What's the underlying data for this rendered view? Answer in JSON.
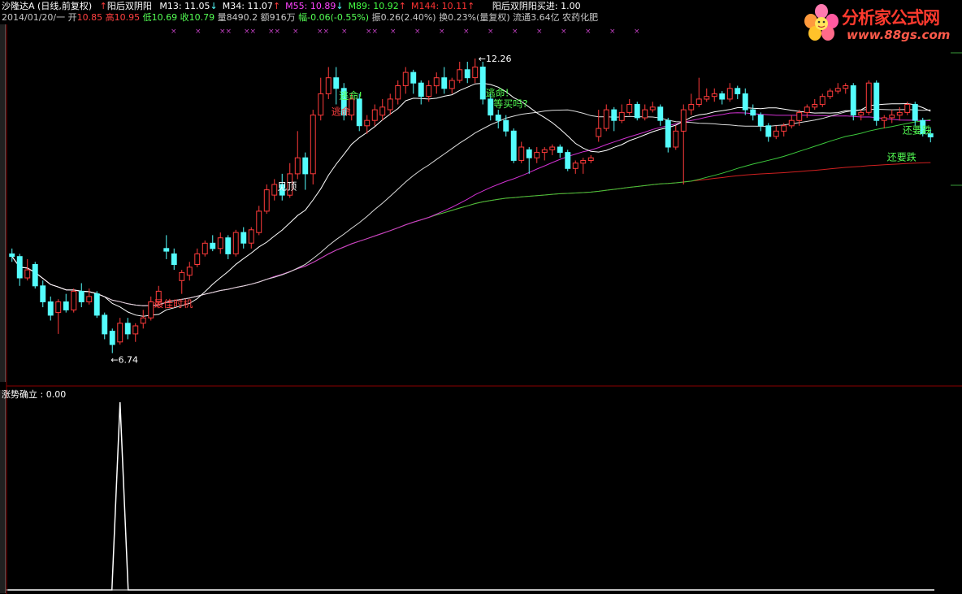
{
  "header": {
    "stock_name": "沙隆达A",
    "chart_mode": "(日线,前复权)",
    "indicator_name": "阳后双阴阳",
    "ma": [
      {
        "label": "M13:",
        "value": "11.05",
        "arrow": "↓",
        "color": "#ffffff"
      },
      {
        "label": "M34:",
        "value": "11.07",
        "arrow": "↑",
        "color": "#ffffff"
      },
      {
        "label": "M55:",
        "value": "10.89",
        "arrow": "↓",
        "color": "#ff44ff"
      },
      {
        "label": "M89:",
        "value": "10.92",
        "arrow": "↑",
        "color": "#44ff44"
      },
      {
        "label": "M144:",
        "value": "10.11",
        "arrow": "↑",
        "color": "#ff3333"
      }
    ],
    "buy_label": "阳后双阴阳买进:",
    "buy_value": "1.00"
  },
  "info_line": {
    "date": "2014/01/20/一",
    "open_label": "开",
    "open": "10.85",
    "high_label": "高",
    "high": "10.95",
    "low_label": "低",
    "low": "10.69",
    "close_label": "收",
    "close": "10.79",
    "volume_label": "量",
    "volume": "8490.2",
    "amount_label": "额",
    "amount": "916万",
    "change_label": "幅",
    "change": "-0.06(-0.55%)",
    "amplitude_label": "振",
    "amplitude": "0.26(2.40%)",
    "turnover_label": "换",
    "turnover": "0.23%(量复权)",
    "float_label": "流通",
    "float": "3.64亿",
    "sector": "农药化肥"
  },
  "logo": {
    "name": "分析家公式网",
    "url": "www.88gs.com"
  },
  "sub_panel": {
    "label": "涨势确立 :",
    "value": "0.00"
  },
  "colors": {
    "up": "#ff3b3b",
    "down": "#54fcfc",
    "m13": "#ffffff",
    "m34": "#dcdcdc",
    "m55": "#d030d0",
    "m89": "#3cc83c",
    "m144": "#d02020",
    "signal": "#ffffff"
  },
  "chart_data": {
    "type": "candlestick",
    "y_scale": {
      "min": 6.2,
      "max": 12.9
    },
    "high_marker": "12.26",
    "low_marker": "6.74",
    "candles": [
      [
        8.6,
        8.55,
        8.7,
        8.45
      ],
      [
        8.55,
        8.15,
        8.6,
        8.0
      ],
      [
        8.15,
        8.3,
        8.5,
        8.1
      ],
      [
        8.4,
        8.0,
        8.45,
        7.95
      ],
      [
        8.0,
        7.7,
        8.1,
        7.6
      ],
      [
        7.7,
        7.45,
        7.8,
        7.35
      ],
      [
        7.5,
        7.7,
        7.75,
        7.1
      ],
      [
        7.7,
        7.55,
        7.85,
        7.5
      ],
      [
        7.55,
        7.9,
        7.95,
        7.5
      ],
      [
        7.9,
        7.7,
        8.05,
        7.6
      ],
      [
        7.7,
        7.8,
        7.95,
        7.65
      ],
      [
        7.85,
        7.45,
        7.9,
        7.4
      ],
      [
        7.45,
        7.1,
        7.5,
        7.0
      ],
      [
        7.15,
        6.9,
        7.2,
        6.74
      ],
      [
        6.95,
        7.3,
        7.4,
        6.9
      ],
      [
        7.3,
        7.1,
        7.4,
        7.0
      ],
      [
        7.1,
        7.25,
        7.3,
        6.95
      ],
      [
        7.3,
        7.4,
        7.55,
        7.2
      ],
      [
        7.4,
        7.7,
        7.8,
        7.35
      ],
      [
        7.7,
        7.9,
        8.0,
        7.65
      ],
      [
        8.7,
        8.65,
        8.95,
        8.5
      ],
      [
        8.6,
        8.4,
        8.7,
        8.3
      ],
      [
        8.1,
        8.25,
        8.3,
        7.85
      ],
      [
        8.2,
        8.35,
        8.45,
        8.1
      ],
      [
        8.4,
        8.6,
        8.7,
        8.35
      ],
      [
        8.6,
        8.8,
        8.85,
        8.55
      ],
      [
        8.8,
        8.7,
        8.95,
        8.65
      ],
      [
        8.7,
        8.9,
        9.0,
        8.6
      ],
      [
        8.9,
        8.6,
        8.95,
        8.5
      ],
      [
        8.6,
        9.0,
        9.05,
        8.55
      ],
      [
        9.0,
        8.8,
        9.1,
        8.7
      ],
      [
        8.8,
        9.05,
        9.1,
        8.7
      ],
      [
        9.0,
        9.4,
        9.5,
        8.95
      ],
      [
        9.4,
        9.8,
        9.9,
        9.35
      ],
      [
        9.7,
        9.9,
        10.0,
        9.6
      ],
      [
        9.9,
        9.7,
        10.1,
        9.6
      ],
      [
        9.7,
        10.1,
        10.3,
        9.65
      ],
      [
        10.1,
        10.4,
        10.9,
        10.0
      ],
      [
        10.4,
        10.1,
        10.5,
        9.8
      ],
      [
        10.1,
        11.2,
        11.3,
        9.9
      ],
      [
        11.2,
        11.6,
        11.9,
        11.1
      ],
      [
        11.6,
        11.9,
        12.1,
        11.5
      ],
      [
        11.9,
        11.7,
        12.1,
        11.4
      ],
      [
        11.7,
        11.2,
        11.8,
        11.1
      ],
      [
        11.2,
        11.5,
        11.6,
        11.1
      ],
      [
        11.5,
        11.0,
        11.6,
        10.9
      ],
      [
        11.0,
        11.1,
        11.2,
        10.85
      ],
      [
        11.1,
        11.3,
        11.4,
        11.0
      ],
      [
        11.2,
        11.35,
        11.5,
        11.1
      ],
      [
        11.3,
        11.5,
        11.6,
        11.2
      ],
      [
        11.5,
        11.75,
        11.85,
        11.4
      ],
      [
        11.75,
        12.0,
        12.1,
        11.6
      ],
      [
        12.0,
        11.8,
        12.05,
        11.6
      ],
      [
        11.8,
        11.55,
        11.85,
        11.4
      ],
      [
        11.55,
        11.75,
        11.85,
        11.45
      ],
      [
        11.75,
        11.9,
        12.0,
        11.6
      ],
      [
        11.9,
        11.7,
        12.1,
        11.6
      ],
      [
        11.7,
        11.85,
        11.9,
        11.6
      ],
      [
        11.85,
        12.05,
        12.2,
        11.8
      ],
      [
        12.05,
        11.9,
        12.2,
        11.8
      ],
      [
        11.9,
        12.1,
        12.26,
        11.8
      ],
      [
        12.1,
        11.5,
        12.2,
        11.4
      ],
      [
        11.5,
        11.2,
        11.6,
        11.1
      ],
      [
        11.2,
        11.1,
        11.3,
        10.95
      ],
      [
        11.1,
        10.9,
        11.2,
        10.8
      ],
      [
        10.9,
        10.35,
        10.95,
        10.3
      ],
      [
        10.35,
        10.6,
        10.7,
        10.3
      ],
      [
        10.55,
        10.4,
        10.6,
        10.1
      ],
      [
        10.4,
        10.5,
        10.6,
        10.3
      ],
      [
        10.5,
        10.55,
        10.6,
        10.35
      ],
      [
        10.55,
        10.6,
        10.65,
        10.45
      ],
      [
        10.6,
        10.5,
        10.65,
        10.4
      ],
      [
        10.5,
        10.2,
        10.55,
        10.15
      ],
      [
        10.2,
        10.3,
        10.35,
        10.1
      ],
      [
        10.3,
        10.35,
        10.4,
        10.1
      ],
      [
        10.35,
        10.4,
        10.45,
        10.3
      ],
      [
        10.8,
        10.95,
        11.3,
        10.7
      ],
      [
        10.95,
        11.3,
        11.4,
        10.9
      ],
      [
        11.3,
        11.1,
        11.35,
        10.9
      ],
      [
        11.1,
        11.25,
        11.4,
        11.05
      ],
      [
        11.25,
        11.4,
        11.5,
        11.2
      ],
      [
        11.4,
        11.15,
        11.45,
        11.1
      ],
      [
        11.15,
        11.3,
        11.4,
        11.1
      ],
      [
        11.3,
        11.35,
        11.45,
        11.25
      ],
      [
        11.35,
        11.1,
        11.4,
        11.0
      ],
      [
        11.1,
        10.6,
        11.15,
        10.5
      ],
      [
        10.6,
        10.9,
        11.0,
        10.55
      ],
      [
        10.9,
        11.3,
        11.4,
        9.9
      ],
      [
        11.3,
        11.4,
        11.6,
        11.2
      ],
      [
        11.4,
        11.5,
        11.9,
        11.35
      ],
      [
        11.5,
        11.55,
        11.7,
        11.45
      ],
      [
        11.55,
        11.6,
        11.7,
        11.45
      ],
      [
        11.6,
        11.5,
        11.65,
        11.4
      ],
      [
        11.5,
        11.7,
        11.8,
        11.45
      ],
      [
        11.7,
        11.6,
        11.75,
        11.5
      ],
      [
        11.6,
        11.3,
        11.7,
        11.2
      ],
      [
        11.3,
        11.2,
        11.4,
        11.1
      ],
      [
        11.2,
        11.0,
        11.25,
        10.9
      ],
      [
        11.0,
        10.8,
        11.05,
        10.7
      ],
      [
        10.8,
        10.9,
        11.0,
        10.75
      ],
      [
        10.9,
        11.0,
        11.05,
        10.8
      ],
      [
        11.0,
        11.1,
        11.2,
        10.95
      ],
      [
        11.1,
        11.25,
        11.3,
        11.0
      ],
      [
        11.25,
        11.35,
        11.4,
        11.15
      ],
      [
        11.35,
        11.4,
        11.5,
        11.3
      ],
      [
        11.4,
        11.55,
        11.6,
        11.35
      ],
      [
        11.55,
        11.65,
        11.7,
        11.5
      ],
      [
        11.65,
        11.7,
        11.8,
        11.6
      ],
      [
        11.7,
        11.75,
        11.8,
        11.6
      ],
      [
        11.75,
        11.2,
        11.8,
        11.1
      ],
      [
        11.2,
        11.25,
        11.3,
        11.1
      ],
      [
        11.25,
        11.8,
        11.85,
        11.2
      ],
      [
        11.8,
        11.1,
        11.85,
        11.0
      ],
      [
        11.1,
        11.15,
        11.2,
        10.95
      ],
      [
        11.15,
        11.2,
        11.3,
        11.05
      ],
      [
        11.2,
        11.25,
        11.35,
        11.1
      ],
      [
        11.25,
        11.4,
        11.45,
        11.2
      ],
      [
        11.4,
        11.1,
        11.45,
        11.0
      ],
      [
        11.1,
        10.85,
        11.15,
        10.8
      ],
      [
        10.85,
        10.79,
        10.95,
        10.69
      ]
    ],
    "signals": [
      {
        "text": "最佳时机",
        "index": 19,
        "price": 7.6,
        "color": "#ff4040"
      },
      {
        "text": "见顶",
        "index": 35,
        "price": 9.8,
        "color": "#ffffff"
      },
      {
        "text": "逃命!",
        "index": 43,
        "price": 11.5,
        "color": "#54ff54"
      },
      {
        "text": "逃命!",
        "index": 62,
        "price": 11.55,
        "color": "#54ff54"
      },
      {
        "text": "等买吗?",
        "index": 63,
        "price": 11.35,
        "color": "#54ff54"
      },
      {
        "text": "还要跌",
        "index": 116,
        "price": 10.85,
        "color": "#54ff54"
      },
      {
        "text": "还要跌",
        "index": 114,
        "price": 10.35,
        "color": "#54ff54"
      },
      {
        "text": "逃命",
        "index": 42,
        "price": 11.2,
        "color": "#ff4040"
      }
    ],
    "sub_signal": {
      "index": 14,
      "value": 1.0
    },
    "legend_marks": "× × ×× ×× ×× × ×× × ×× × × × × × × × × × × ×"
  }
}
